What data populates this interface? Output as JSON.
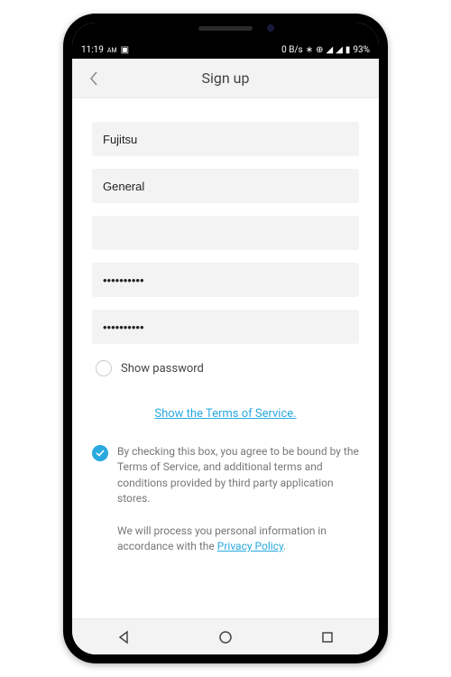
{
  "status": {
    "time": "11:19",
    "am": "AM",
    "speed": "0 B/s",
    "battery": "93%"
  },
  "header": {
    "title": "Sign up"
  },
  "form": {
    "first_name": "Fujitsu",
    "last_name": "General",
    "email": "",
    "password": "••••••••••",
    "confirm_password": "••••••••••",
    "show_password_label": "Show password"
  },
  "tos": {
    "link_text": "Show the Terms of Service.",
    "agree_text": "By checking this box, you agree to be bound by the Terms of Service, and additional terms and conditions provided by third party application stores."
  },
  "privacy": {
    "prefix": "We will process you personal information in accordance with the ",
    "link": "Privacy Policy",
    "suffix": "."
  }
}
